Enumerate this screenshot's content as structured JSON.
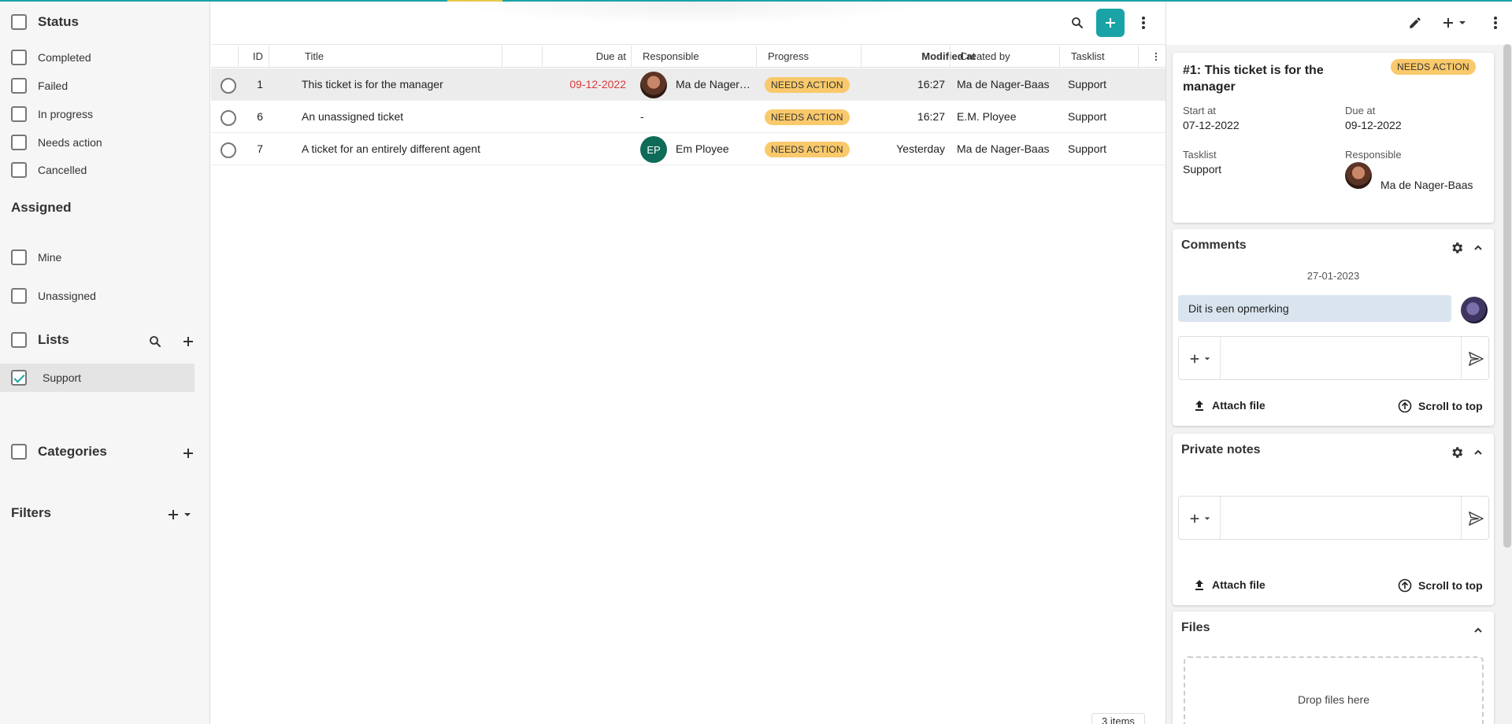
{
  "sidebar": {
    "status": {
      "title": "Status",
      "items": [
        {
          "label": "Completed",
          "checked": false
        },
        {
          "label": "Failed",
          "checked": false
        },
        {
          "label": "In progress",
          "checked": false
        },
        {
          "label": "Needs action",
          "checked": false
        },
        {
          "label": "Cancelled",
          "checked": false
        }
      ]
    },
    "assigned": {
      "title": "Assigned",
      "items": [
        {
          "label": "Mine",
          "checked": false
        },
        {
          "label": "Unassigned",
          "checked": false
        }
      ]
    },
    "lists": {
      "title": "Lists",
      "items": [
        {
          "label": "Support",
          "checked": true
        }
      ]
    },
    "categories": {
      "title": "Categories"
    },
    "filters": {
      "title": "Filters"
    }
  },
  "grid": {
    "columns": {
      "id": "ID",
      "title": "Title",
      "due_at": "Due at",
      "responsible": "Responsible",
      "progress": "Progress",
      "modified_at": "Modified at",
      "sort_indicator": "↑",
      "created_by": "Created by",
      "tasklist": "Tasklist"
    },
    "rows": [
      {
        "id": "1",
        "title": "This ticket is for the manager",
        "due_at": "09-12-2022",
        "responsible": "Ma de Nager…",
        "progress": "NEEDS ACTION",
        "modified_at": "16:27",
        "created_by": "Ma de Nager-Baas",
        "tasklist": "Support"
      },
      {
        "id": "6",
        "title": "An unassigned ticket",
        "due_at": "",
        "responsible": "-",
        "progress": "NEEDS ACTION",
        "modified_at": "16:27",
        "created_by": "E.M. Ployee",
        "tasklist": "Support"
      },
      {
        "id": "7",
        "title": "A ticket for an entirely different agent",
        "due_at": "",
        "responsible": "Em Ployee",
        "responsible_initials": "EP",
        "progress": "NEEDS ACTION",
        "modified_at": "Yesterday",
        "created_by": "Ma de Nager-Baas",
        "tasklist": "Support"
      }
    ],
    "count_label": "3 items"
  },
  "detail": {
    "title": "#1: This ticket is for the manager",
    "status": "NEEDS ACTION",
    "start_label": "Start at",
    "start_value": "07-12-2022",
    "due_label": "Due at",
    "due_value": "09-12-2022",
    "tasklist_label": "Tasklist",
    "tasklist_value": "Support",
    "responsible_label": "Responsible",
    "responsible_value": "Ma de Nager-Baas"
  },
  "comments": {
    "title": "Comments",
    "date": "27-01-2023",
    "items": [
      {
        "text": "Dit is een opmerking"
      }
    ],
    "attach_label": "Attach file",
    "scroll_label": "Scroll to top"
  },
  "private_notes": {
    "title": "Private notes",
    "attach_label": "Attach file",
    "scroll_label": "Scroll to top"
  },
  "files": {
    "title": "Files",
    "drop_label": "Drop files here"
  },
  "colors": {
    "accent": "#1aa3a6",
    "badge": "#f9c96b",
    "due_overdue": "#d93a3a"
  }
}
